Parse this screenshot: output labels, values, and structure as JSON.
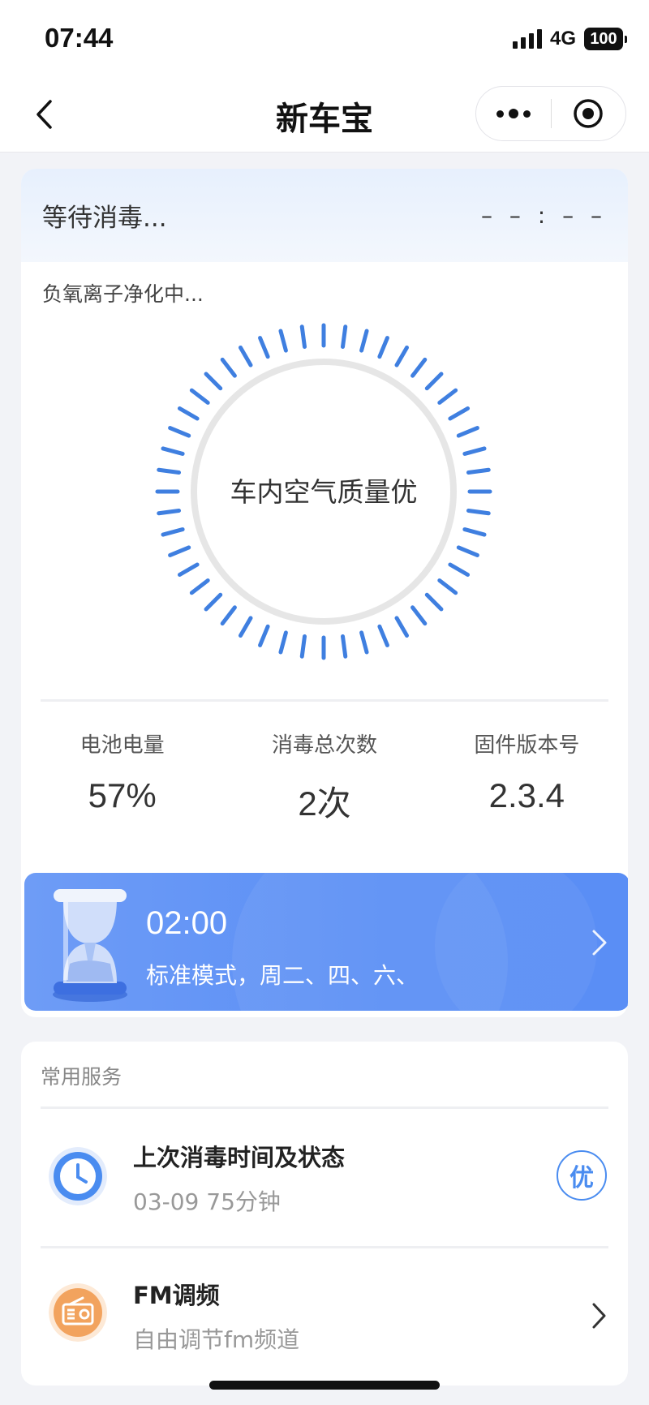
{
  "status_bar": {
    "time": "07:44",
    "network": "4G",
    "battery": "100"
  },
  "nav": {
    "title": "新车宝"
  },
  "device": {
    "wait_status": "等待消毒...",
    "countdown": "– – : – –",
    "purify_status": "负氧离子净化中...",
    "air_quality": "车内空气质量优"
  },
  "stats": [
    {
      "label": "电池电量",
      "value": "57%"
    },
    {
      "label": "消毒总次数",
      "value": "2次"
    },
    {
      "label": "固件版本号",
      "value": "2.3.4"
    }
  ],
  "schedule": {
    "time": "02:00",
    "description": "标准模式，周二、四、六、"
  },
  "services": {
    "title": "常用服务",
    "items": [
      {
        "name": "上次消毒时间及状态",
        "sub": "03-09    75分钟",
        "badge": "优",
        "icon": "clock-icon"
      },
      {
        "name": "FM调频",
        "sub": "自由调节fm频道",
        "icon": "radio-icon"
      }
    ]
  },
  "colors": {
    "accent": "#3f7fe0",
    "schedule_bg": "#5b8ff5",
    "radio_icon": "#f2a35e"
  }
}
